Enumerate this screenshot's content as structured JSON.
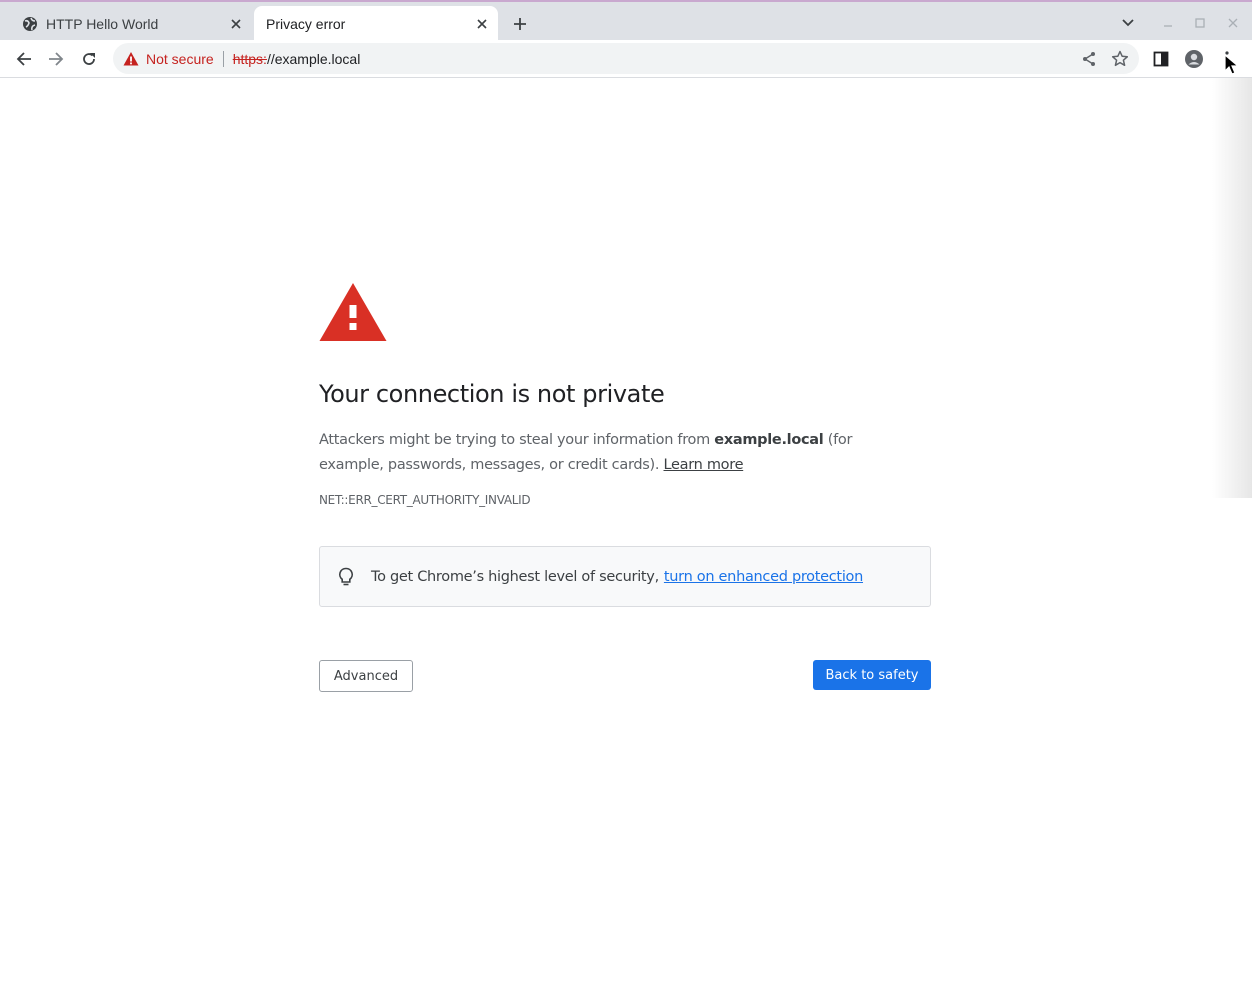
{
  "tabs": [
    {
      "title": "HTTP Hello World",
      "active": false,
      "icon": "globe-icon"
    },
    {
      "title": "Privacy error",
      "active": true,
      "icon": ""
    }
  ],
  "toolbar": {
    "security_label": "Not secure",
    "url_scheme": "https:",
    "url_rest": "//example.local"
  },
  "interstitial": {
    "heading": "Your connection is not private",
    "explanation_pre": "Attackers might be trying to steal your information from ",
    "explanation_host": "example.local",
    "explanation_post": " (for example, passwords, messages, or credit cards).",
    "learn_more": "Learn more",
    "error_code": "NET::ERR_CERT_AUTHORITY_INVALID",
    "enhanced_text": "To get Chrome’s highest level of security,",
    "enhanced_link": "turn on enhanced protection",
    "advanced_button": "Advanced",
    "back_button": "Back to safety"
  },
  "colors": {
    "warning_red": "#d93025",
    "link_blue": "#1a73e8",
    "primary_button": "#1a73e8",
    "tabstrip_bg": "#dee1e6"
  }
}
